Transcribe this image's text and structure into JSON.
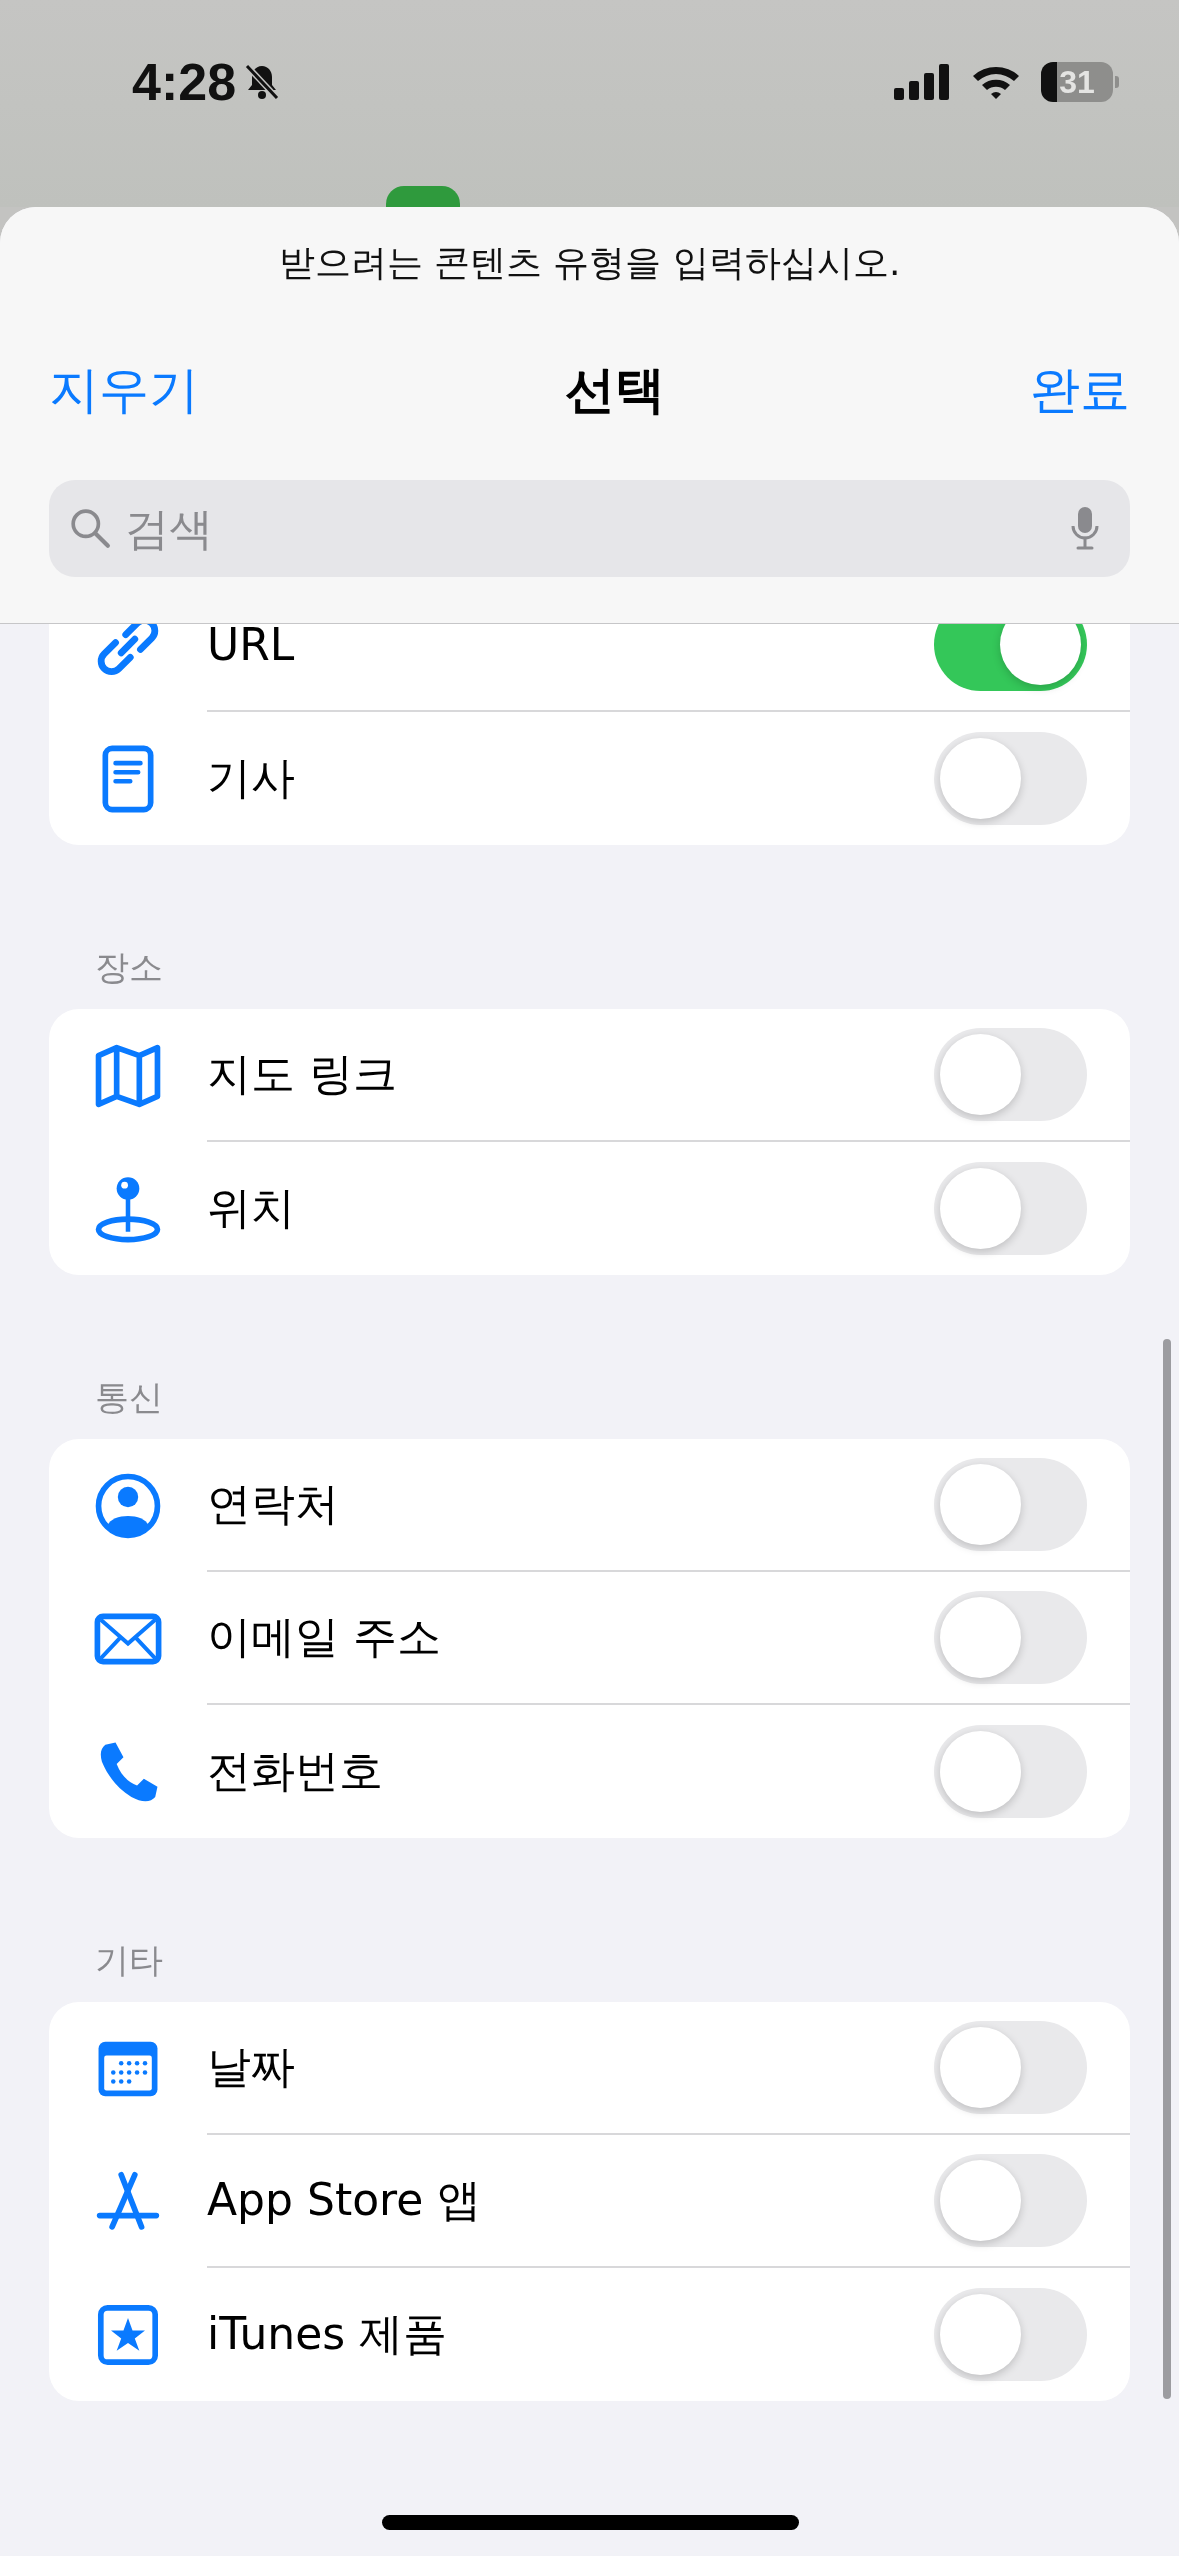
{
  "status_bar": {
    "time": "4:28",
    "silent": true,
    "battery": "31"
  },
  "sheet": {
    "prompt": "받으려는 콘텐츠 유형을 입력하십시오.",
    "clear_button": "지우기",
    "title": "선택",
    "done_button": "완료",
    "search": {
      "placeholder": "검색"
    }
  },
  "sections": [
    {
      "items": [
        {
          "kind": "link",
          "label": "URL",
          "on": true
        },
        {
          "kind": "article",
          "label": "기사",
          "on": false
        }
      ]
    },
    {
      "header": "장소",
      "items": [
        {
          "kind": "map",
          "label": "지도 링크",
          "on": false
        },
        {
          "kind": "location",
          "label": "위치",
          "on": false
        }
      ]
    },
    {
      "header": "통신",
      "items": [
        {
          "kind": "contact",
          "label": "연락처",
          "on": false
        },
        {
          "kind": "email",
          "label": "이메일 주소",
          "on": false
        },
        {
          "kind": "phone",
          "label": "전화번호",
          "on": false
        }
      ]
    },
    {
      "header": "기타",
      "items": [
        {
          "kind": "date",
          "label": "날짜",
          "on": false
        },
        {
          "kind": "appstore",
          "label": "App Store 앱",
          "on": false
        },
        {
          "kind": "itunes",
          "label": "iTunes 제품",
          "on": false
        }
      ]
    }
  ]
}
